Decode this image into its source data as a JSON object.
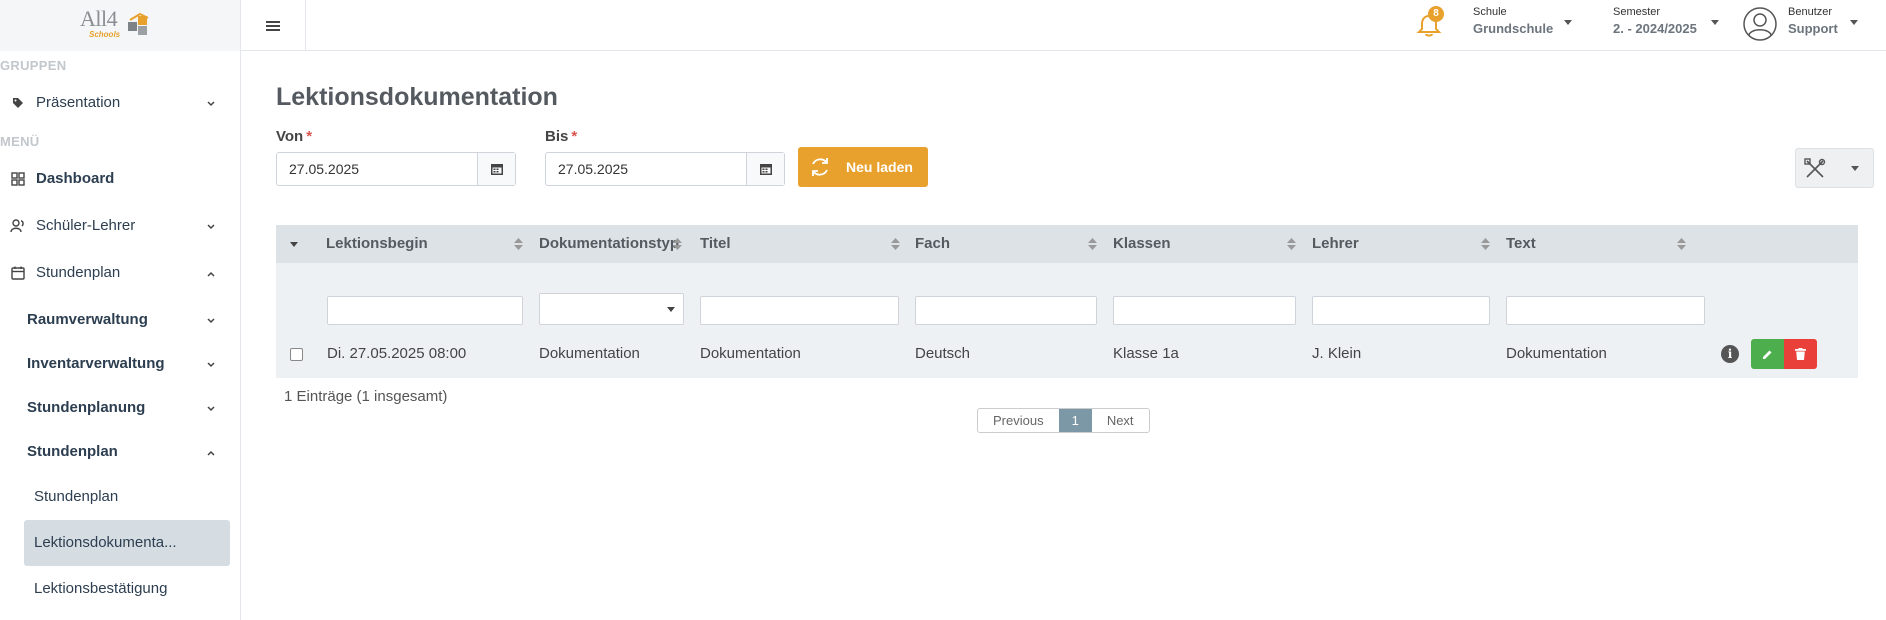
{
  "brand": {
    "logo_text": "All4",
    "logo_sub": "Schools"
  },
  "header": {
    "notification_count": "8",
    "school": {
      "label": "Schule",
      "value": "Grundschule"
    },
    "semester": {
      "label": "Semester",
      "value": "2. - 2024/2025"
    },
    "user": {
      "label": "Benutzer",
      "value": "Support"
    }
  },
  "sidebar": {
    "groups_label": "GRUPPEN",
    "group_item": "Präsentation",
    "menu_label": "MENÜ",
    "items": [
      {
        "label": "Dashboard"
      },
      {
        "label": "Schüler-Lehrer"
      },
      {
        "label": "Stundenplan"
      }
    ],
    "sub_items": [
      {
        "label": "Raumverwaltung"
      },
      {
        "label": "Inventarverwaltung"
      },
      {
        "label": "Stundenplanung"
      },
      {
        "label": "Stundenplan"
      }
    ],
    "sub2_items": [
      {
        "label": "Stundenplan"
      },
      {
        "label": "Lektionsdokumenta..."
      },
      {
        "label": "Lektionsbestätigung"
      }
    ]
  },
  "page": {
    "title": "Lektionsdokumentation",
    "from_label": "Von",
    "from_value": "27.05.2025",
    "to_label": "Bis",
    "to_value": "27.05.2025",
    "reload_label": "Neu laden"
  },
  "table": {
    "columns": [
      "Lektionsbegin",
      "Dokumentationstyp",
      "Titel",
      "Fach",
      "Klassen",
      "Lehrer",
      "Text"
    ],
    "rows": [
      [
        "Di. 27.05.2025 08:00",
        "Dokumentation",
        "Dokumentation",
        "Deutsch",
        "Klasse 1a",
        "J. Klein",
        "Dokumentation"
      ]
    ],
    "entries_info": "1 Einträge (1 insgesamt)"
  },
  "pagination": {
    "previous": "Previous",
    "current": "1",
    "next": "Next"
  },
  "colors": {
    "accent": "#e8a12c",
    "edit": "#4cae4c",
    "delete": "#e9403a",
    "active_page": "#7c98a6"
  }
}
